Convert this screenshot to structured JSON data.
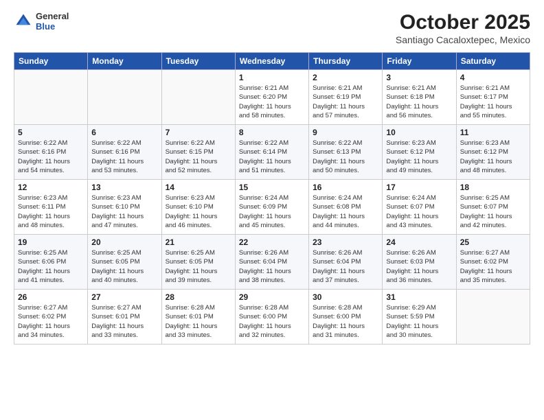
{
  "header": {
    "logo_general": "General",
    "logo_blue": "Blue",
    "month_title": "October 2025",
    "location": "Santiago Cacaloxtepec, Mexico"
  },
  "weekdays": [
    "Sunday",
    "Monday",
    "Tuesday",
    "Wednesday",
    "Thursday",
    "Friday",
    "Saturday"
  ],
  "weeks": [
    [
      {
        "day": "",
        "info": ""
      },
      {
        "day": "",
        "info": ""
      },
      {
        "day": "",
        "info": ""
      },
      {
        "day": "1",
        "info": "Sunrise: 6:21 AM\nSunset: 6:20 PM\nDaylight: 11 hours\nand 58 minutes."
      },
      {
        "day": "2",
        "info": "Sunrise: 6:21 AM\nSunset: 6:19 PM\nDaylight: 11 hours\nand 57 minutes."
      },
      {
        "day": "3",
        "info": "Sunrise: 6:21 AM\nSunset: 6:18 PM\nDaylight: 11 hours\nand 56 minutes."
      },
      {
        "day": "4",
        "info": "Sunrise: 6:21 AM\nSunset: 6:17 PM\nDaylight: 11 hours\nand 55 minutes."
      }
    ],
    [
      {
        "day": "5",
        "info": "Sunrise: 6:22 AM\nSunset: 6:16 PM\nDaylight: 11 hours\nand 54 minutes."
      },
      {
        "day": "6",
        "info": "Sunrise: 6:22 AM\nSunset: 6:16 PM\nDaylight: 11 hours\nand 53 minutes."
      },
      {
        "day": "7",
        "info": "Sunrise: 6:22 AM\nSunset: 6:15 PM\nDaylight: 11 hours\nand 52 minutes."
      },
      {
        "day": "8",
        "info": "Sunrise: 6:22 AM\nSunset: 6:14 PM\nDaylight: 11 hours\nand 51 minutes."
      },
      {
        "day": "9",
        "info": "Sunrise: 6:22 AM\nSunset: 6:13 PM\nDaylight: 11 hours\nand 50 minutes."
      },
      {
        "day": "10",
        "info": "Sunrise: 6:23 AM\nSunset: 6:12 PM\nDaylight: 11 hours\nand 49 minutes."
      },
      {
        "day": "11",
        "info": "Sunrise: 6:23 AM\nSunset: 6:12 PM\nDaylight: 11 hours\nand 48 minutes."
      }
    ],
    [
      {
        "day": "12",
        "info": "Sunrise: 6:23 AM\nSunset: 6:11 PM\nDaylight: 11 hours\nand 48 minutes."
      },
      {
        "day": "13",
        "info": "Sunrise: 6:23 AM\nSunset: 6:10 PM\nDaylight: 11 hours\nand 47 minutes."
      },
      {
        "day": "14",
        "info": "Sunrise: 6:23 AM\nSunset: 6:10 PM\nDaylight: 11 hours\nand 46 minutes."
      },
      {
        "day": "15",
        "info": "Sunrise: 6:24 AM\nSunset: 6:09 PM\nDaylight: 11 hours\nand 45 minutes."
      },
      {
        "day": "16",
        "info": "Sunrise: 6:24 AM\nSunset: 6:08 PM\nDaylight: 11 hours\nand 44 minutes."
      },
      {
        "day": "17",
        "info": "Sunrise: 6:24 AM\nSunset: 6:07 PM\nDaylight: 11 hours\nand 43 minutes."
      },
      {
        "day": "18",
        "info": "Sunrise: 6:25 AM\nSunset: 6:07 PM\nDaylight: 11 hours\nand 42 minutes."
      }
    ],
    [
      {
        "day": "19",
        "info": "Sunrise: 6:25 AM\nSunset: 6:06 PM\nDaylight: 11 hours\nand 41 minutes."
      },
      {
        "day": "20",
        "info": "Sunrise: 6:25 AM\nSunset: 6:05 PM\nDaylight: 11 hours\nand 40 minutes."
      },
      {
        "day": "21",
        "info": "Sunrise: 6:25 AM\nSunset: 6:05 PM\nDaylight: 11 hours\nand 39 minutes."
      },
      {
        "day": "22",
        "info": "Sunrise: 6:26 AM\nSunset: 6:04 PM\nDaylight: 11 hours\nand 38 minutes."
      },
      {
        "day": "23",
        "info": "Sunrise: 6:26 AM\nSunset: 6:04 PM\nDaylight: 11 hours\nand 37 minutes."
      },
      {
        "day": "24",
        "info": "Sunrise: 6:26 AM\nSunset: 6:03 PM\nDaylight: 11 hours\nand 36 minutes."
      },
      {
        "day": "25",
        "info": "Sunrise: 6:27 AM\nSunset: 6:02 PM\nDaylight: 11 hours\nand 35 minutes."
      }
    ],
    [
      {
        "day": "26",
        "info": "Sunrise: 6:27 AM\nSunset: 6:02 PM\nDaylight: 11 hours\nand 34 minutes."
      },
      {
        "day": "27",
        "info": "Sunrise: 6:27 AM\nSunset: 6:01 PM\nDaylight: 11 hours\nand 33 minutes."
      },
      {
        "day": "28",
        "info": "Sunrise: 6:28 AM\nSunset: 6:01 PM\nDaylight: 11 hours\nand 33 minutes."
      },
      {
        "day": "29",
        "info": "Sunrise: 6:28 AM\nSunset: 6:00 PM\nDaylight: 11 hours\nand 32 minutes."
      },
      {
        "day": "30",
        "info": "Sunrise: 6:28 AM\nSunset: 6:00 PM\nDaylight: 11 hours\nand 31 minutes."
      },
      {
        "day": "31",
        "info": "Sunrise: 6:29 AM\nSunset: 5:59 PM\nDaylight: 11 hours\nand 30 minutes."
      },
      {
        "day": "",
        "info": ""
      }
    ]
  ]
}
